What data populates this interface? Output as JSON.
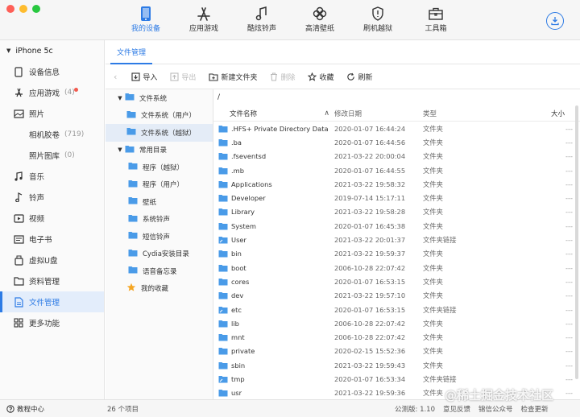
{
  "nav": {
    "tabs": [
      {
        "label": "我的设备",
        "icon": "phone-icon",
        "active": true
      },
      {
        "label": "应用游戏",
        "icon": "app-store-icon",
        "active": false
      },
      {
        "label": "酷炫铃声",
        "icon": "music-note-icon",
        "active": false
      },
      {
        "label": "高清壁纸",
        "icon": "clover-icon",
        "active": false
      },
      {
        "label": "刷机越狱",
        "icon": "shield-icon",
        "active": false
      },
      {
        "label": "工具箱",
        "icon": "toolbox-icon",
        "active": false
      }
    ],
    "download_icon": "download-icon",
    "accent": "#2d7be5"
  },
  "sidebar": {
    "device": "iPhone 5c",
    "items": [
      {
        "label": "设备信息",
        "icon": "device-info-icon"
      },
      {
        "label": "应用游戏",
        "icon": "app-icon",
        "count": "(4)"
      },
      {
        "label": "照片",
        "icon": "photo-icon"
      },
      {
        "label": "相机胶卷",
        "count": "(719)"
      },
      {
        "label": "照片图库",
        "count": "(0)"
      },
      {
        "label": "音乐",
        "icon": "music-icon"
      },
      {
        "label": "铃声",
        "icon": "ringtone-icon"
      },
      {
        "label": "视频",
        "icon": "video-icon"
      },
      {
        "label": "电子书",
        "icon": "ebook-icon"
      },
      {
        "label": "虚拟U盘",
        "icon": "usb-icon"
      },
      {
        "label": "资料管理",
        "icon": "data-icon"
      },
      {
        "label": "文件管理",
        "icon": "file-icon",
        "active": true
      },
      {
        "label": "更多功能",
        "icon": "more-icon"
      }
    ]
  },
  "main": {
    "tab": "文件管理",
    "toolbar": {
      "import": "导入",
      "export": "导出",
      "new_folder": "新建文件夹",
      "delete": "删除",
      "favorite": "收藏",
      "refresh": "刷新"
    },
    "tree": {
      "fs": "文件系统",
      "fs_user": "文件系统（用户）",
      "fs_jail": "文件系统（越狱）",
      "common": "常用目录",
      "apps_jail": "程序（越狱）",
      "apps_user": "程序（用户）",
      "wallpaper": "壁纸",
      "sys_ring": "系统铃声",
      "sms_ring": "短信铃声",
      "cydia": "Cydia安装目录",
      "voice": "语音备忘录",
      "favorites": "我的收藏"
    },
    "path": "/",
    "columns": {
      "name": "文件名称",
      "date": "修改日期",
      "type": "类型",
      "size": "大小"
    },
    "files": [
      {
        "name": ".HFS+ Private Directory Data",
        "date": "2020-01-07 16:44:24",
        "type": "文件夹",
        "size": "---"
      },
      {
        "name": ".ba",
        "date": "2020-01-07 16:44:56",
        "type": "文件夹",
        "size": "---"
      },
      {
        "name": ".fseventsd",
        "date": "2021-03-22 20:00:04",
        "type": "文件夹",
        "size": "---"
      },
      {
        "name": ".mb",
        "date": "2020-01-07 16:44:55",
        "type": "文件夹",
        "size": "---"
      },
      {
        "name": "Applications",
        "date": "2021-03-22 19:58:32",
        "type": "文件夹",
        "size": "---"
      },
      {
        "name": "Developer",
        "date": "2019-07-14 15:17:11",
        "type": "文件夹",
        "size": "---"
      },
      {
        "name": "Library",
        "date": "2021-03-22 19:58:28",
        "type": "文件夹",
        "size": "---"
      },
      {
        "name": "System",
        "date": "2020-01-07 16:45:38",
        "type": "文件夹",
        "size": "---"
      },
      {
        "name": "User",
        "date": "2021-03-22 20:01:37",
        "type": "文件夹链接",
        "size": "---"
      },
      {
        "name": "bin",
        "date": "2021-03-22 19:59:37",
        "type": "文件夹",
        "size": "---"
      },
      {
        "name": "boot",
        "date": "2006-10-28 22:07:42",
        "type": "文件夹",
        "size": "---"
      },
      {
        "name": "cores",
        "date": "2020-01-07 16:53:15",
        "type": "文件夹",
        "size": "---"
      },
      {
        "name": "dev",
        "date": "2021-03-22 19:57:10",
        "type": "文件夹",
        "size": "---"
      },
      {
        "name": "etc",
        "date": "2020-01-07 16:53:15",
        "type": "文件夹链接",
        "size": "---"
      },
      {
        "name": "lib",
        "date": "2006-10-28 22:07:42",
        "type": "文件夹",
        "size": "---"
      },
      {
        "name": "mnt",
        "date": "2006-10-28 22:07:42",
        "type": "文件夹",
        "size": "---"
      },
      {
        "name": "private",
        "date": "2020-02-15 15:52:36",
        "type": "文件夹",
        "size": "---"
      },
      {
        "name": "sbin",
        "date": "2021-03-22 19:59:43",
        "type": "文件夹",
        "size": "---"
      },
      {
        "name": "tmp",
        "date": "2020-01-07 16:53:34",
        "type": "文件夹链接",
        "size": "---"
      },
      {
        "name": "usr",
        "date": "2021-03-22 19:59:36",
        "type": "文件夹",
        "size": "---"
      }
    ]
  },
  "status": {
    "help": "教程中心",
    "count": "26 个项目",
    "version": "公测版: 1.10",
    "feedback": "意见反馈",
    "wechat": "锦信公众号",
    "update": "检查更新",
    "watermark": "@稀土掘金技术社区"
  }
}
